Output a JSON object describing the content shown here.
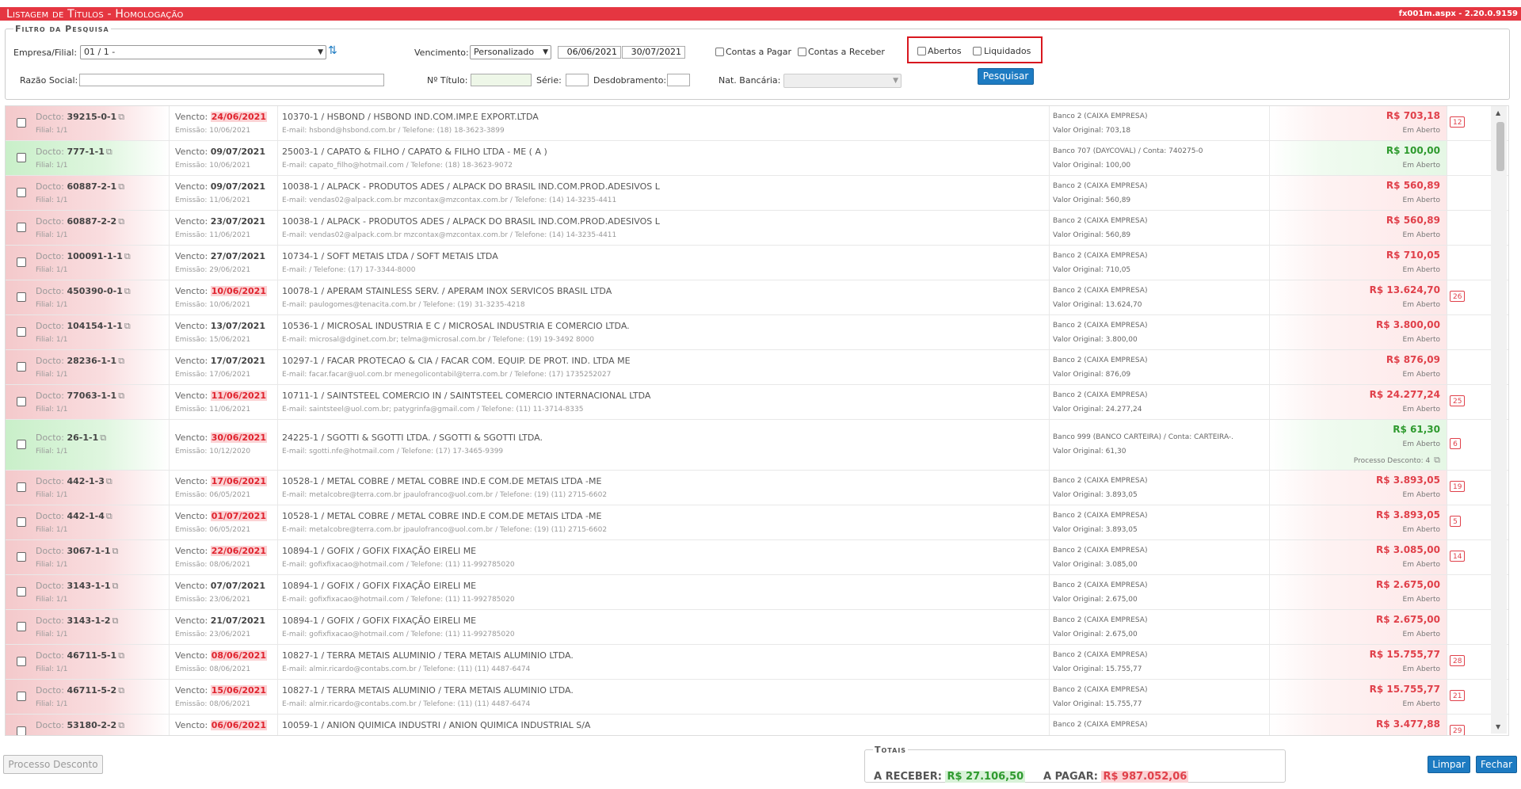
{
  "header": {
    "title": "Listagem de Títulos  - Homologação",
    "version": "fx001m.aspx - 2.20.0.9159"
  },
  "filter": {
    "legend": "Filtro da Pesquisa",
    "empresa_label": "Empresa/Filial:",
    "empresa_value": "01 / 1 -",
    "vencimento_label": "Vencimento:",
    "vencimento_value": "Personalizado",
    "date_from": "06/06/2021",
    "date_to": "30/07/2021",
    "contas_pagar": "Contas a Pagar",
    "contas_receber": "Contas a Receber",
    "abertos": "Abertos",
    "liquidados": "Liquidados",
    "razao_label": "Razão Social:",
    "razao_value": "",
    "titulo_label": "Nº Título:",
    "serie_label": "Série:",
    "desdobramento_label": "Desdobramento:",
    "natbancaria_label": "Nat. Bancária:",
    "pesquisar": "Pesquisar"
  },
  "labels": {
    "docto": "Docto:",
    "filial": "Filial: 1/1",
    "vencto": "Vencto:",
    "emissao": "Emissão:",
    "valor_original": "Valor Original:",
    "email": "E-mail:",
    "telefone": "Telefone:"
  },
  "rows": [
    {
      "status": "red",
      "doc": "39215-0-1",
      "venc": "24/06/2021",
      "late": true,
      "emis": "10/06/2021",
      "cli": "10370-1 / HSBOND / HSBOND IND.COM.IMP.E EXPORT.LTDA",
      "mail": "E-mail: hsbond@hsbond.com.br / Telefone: (18) 18-3623-3899",
      "banco": "Banco 2 (CAIXA EMPRESA)",
      "vorig": "Valor Original: 703,18",
      "valor": "R$ 703,18",
      "stat": "Em Aberto",
      "badge": "12"
    },
    {
      "status": "green",
      "doc": "777-1-1",
      "venc": "09/07/2021",
      "late": false,
      "emis": "10/06/2021",
      "cli": "25003-1 / CAPATO & FILHO / CAPATO & FILHO LTDA - ME ( A )",
      "mail": "E-mail: capato_filho@hotmail.com / Telefone: (18) 18-3623-9072",
      "banco": "Banco 707 (DAYCOVAL) / Conta: 740275-0",
      "vorig": "Valor Original: 100,00",
      "valor": "R$ 100,00",
      "stat": "Em Aberto",
      "badge": ""
    },
    {
      "status": "red",
      "doc": "60887-2-1",
      "venc": "09/07/2021",
      "late": false,
      "emis": "11/06/2021",
      "cli": "10038-1 / ALPACK - PRODUTOS ADES / ALPACK DO BRASIL IND.COM.PROD.ADESIVOS L",
      "mail": "E-mail: vendas02@alpack.com.br mzcontax@mzcontax.com.br / Telefone: (14) 14-3235-4411",
      "banco": "Banco 2 (CAIXA EMPRESA)",
      "vorig": "Valor Original: 560,89",
      "valor": "R$ 560,89",
      "stat": "Em Aberto",
      "badge": ""
    },
    {
      "status": "red",
      "doc": "60887-2-2",
      "venc": "23/07/2021",
      "late": false,
      "emis": "11/06/2021",
      "cli": "10038-1 / ALPACK - PRODUTOS ADES / ALPACK DO BRASIL IND.COM.PROD.ADESIVOS L",
      "mail": "E-mail: vendas02@alpack.com.br mzcontax@mzcontax.com.br / Telefone: (14) 14-3235-4411",
      "banco": "Banco 2 (CAIXA EMPRESA)",
      "vorig": "Valor Original: 560,89",
      "valor": "R$ 560,89",
      "stat": "Em Aberto",
      "badge": ""
    },
    {
      "status": "red",
      "doc": "100091-1-1",
      "venc": "27/07/2021",
      "late": false,
      "emis": "29/06/2021",
      "cli": "10734-1 / SOFT METAIS LTDA / SOFT METAIS LTDA",
      "mail": "E-mail: / Telefone: (17) 17-3344-8000",
      "banco": "Banco 2 (CAIXA EMPRESA)",
      "vorig": "Valor Original: 710,05",
      "valor": "R$ 710,05",
      "stat": "Em Aberto",
      "badge": ""
    },
    {
      "status": "red",
      "doc": "450390-0-1",
      "venc": "10/06/2021",
      "late": true,
      "emis": "10/06/2021",
      "cli": "10078-1 / APERAM STAINLESS SERV. / APERAM INOX SERVICOS BRASIL LTDA",
      "mail": "E-mail: paulogomes@tenacita.com.br / Telefone: (19) 31-3235-4218",
      "banco": "Banco 2 (CAIXA EMPRESA)",
      "vorig": "Valor Original: 13.624,70",
      "valor": "R$ 13.624,70",
      "stat": "Em Aberto",
      "badge": "26"
    },
    {
      "status": "red",
      "doc": "104154-1-1",
      "venc": "13/07/2021",
      "late": false,
      "emis": "15/06/2021",
      "cli": "10536-1 / MICROSAL INDUSTRIA E C / MICROSAL INDUSTRIA E COMERCIO LTDA.",
      "mail": "E-mail: microsal@dginet.com.br; telma@microsal.com.br / Telefone: (19) 19-3492 8000",
      "banco": "Banco 2 (CAIXA EMPRESA)",
      "vorig": "Valor Original: 3.800,00",
      "valor": "R$ 3.800,00",
      "stat": "Em Aberto",
      "badge": ""
    },
    {
      "status": "red",
      "doc": "28236-1-1",
      "venc": "17/07/2021",
      "late": false,
      "emis": "17/06/2021",
      "cli": "10297-1 / FACAR PROTECAO & CIA / FACAR COM. EQUIP. DE PROT. IND. LTDA ME",
      "mail": "E-mail: facar.facar@uol.com.br menegolicontabil@terra.com.br / Telefone: (17) 1735252027",
      "banco": "Banco 2 (CAIXA EMPRESA)",
      "vorig": "Valor Original: 876,09",
      "valor": "R$ 876,09",
      "stat": "Em Aberto",
      "badge": ""
    },
    {
      "status": "red",
      "doc": "77063-1-1",
      "venc": "11/06/2021",
      "late": true,
      "emis": "11/06/2021",
      "cli": "10711-1 / SAINTSTEEL COMERCIO IN / SAINTSTEEL COMERCIO INTERNACIONAL LTDA",
      "mail": "E-mail: saintsteel@uol.com.br; patygrinfa@gmail.com / Telefone: (11) 11-3714-8335",
      "banco": "Banco 2 (CAIXA EMPRESA)",
      "vorig": "Valor Original: 24.277,24",
      "valor": "R$ 24.277,24",
      "stat": "Em Aberto",
      "badge": "25"
    },
    {
      "status": "green",
      "tall": true,
      "doc": "26-1-1",
      "venc": "30/06/2021",
      "late": true,
      "emis": "10/12/2020",
      "cli": "24225-1 / SGOTTI & SGOTTI LTDA. / SGOTTI & SGOTTI LTDA.",
      "mail": "E-mail: sgotti.nfe@hotmail.com / Telefone: (17) 17-3465-9399",
      "banco": "Banco 999 (BANCO CARTEIRA) / Conta: CARTEIRA-.",
      "vorig": "Valor Original: 61,30",
      "valor": "R$ 61,30",
      "stat": "Em Aberto",
      "pdesc": "Processo Desconto: 4",
      "badge": "6"
    },
    {
      "status": "red",
      "doc": "442-1-3",
      "venc": "17/06/2021",
      "late": true,
      "emis": "06/05/2021",
      "cli": "10528-1 / METAL COBRE / METAL COBRE IND.E COM.DE METAIS LTDA -ME",
      "mail": "E-mail: metalcobre@terra.com.br jpaulofranco@uol.com.br / Telefone: (19) (11) 2715-6602",
      "banco": "Banco 2 (CAIXA EMPRESA)",
      "vorig": "Valor Original: 3.893,05",
      "valor": "R$ 3.893,05",
      "stat": "Em Aberto",
      "badge": "19"
    },
    {
      "status": "red",
      "doc": "442-1-4",
      "venc": "01/07/2021",
      "late": true,
      "emis": "06/05/2021",
      "cli": "10528-1 / METAL COBRE / METAL COBRE IND.E COM.DE METAIS LTDA -ME",
      "mail": "E-mail: metalcobre@terra.com.br jpaulofranco@uol.com.br / Telefone: (19) (11) 2715-6602",
      "banco": "Banco 2 (CAIXA EMPRESA)",
      "vorig": "Valor Original: 3.893,05",
      "valor": "R$ 3.893,05",
      "stat": "Em Aberto",
      "badge": "5"
    },
    {
      "status": "red",
      "doc": "3067-1-1",
      "venc": "22/06/2021",
      "late": true,
      "emis": "08/06/2021",
      "cli": "10894-1 / GOFIX / GOFIX FIXAÇÃO EIRELI ME",
      "mail": "E-mail: gofixfixacao@hotmail.com / Telefone: (11) 11-992785020",
      "banco": "Banco 2 (CAIXA EMPRESA)",
      "vorig": "Valor Original: 3.085,00",
      "valor": "R$ 3.085,00",
      "stat": "Em Aberto",
      "badge": "14"
    },
    {
      "status": "red",
      "doc": "3143-1-1",
      "venc": "07/07/2021",
      "late": false,
      "emis": "23/06/2021",
      "cli": "10894-1 / GOFIX / GOFIX FIXAÇÃO EIRELI ME",
      "mail": "E-mail: gofixfixacao@hotmail.com / Telefone: (11) 11-992785020",
      "banco": "Banco 2 (CAIXA EMPRESA)",
      "vorig": "Valor Original: 2.675,00",
      "valor": "R$ 2.675,00",
      "stat": "Em Aberto",
      "badge": ""
    },
    {
      "status": "red",
      "doc": "3143-1-2",
      "venc": "21/07/2021",
      "late": false,
      "emis": "23/06/2021",
      "cli": "10894-1 / GOFIX / GOFIX FIXAÇÃO EIRELI ME",
      "mail": "E-mail: gofixfixacao@hotmail.com / Telefone: (11) 11-992785020",
      "banco": "Banco 2 (CAIXA EMPRESA)",
      "vorig": "Valor Original: 2.675,00",
      "valor": "R$ 2.675,00",
      "stat": "Em Aberto",
      "badge": ""
    },
    {
      "status": "red",
      "doc": "46711-5-1",
      "venc": "08/06/2021",
      "late": true,
      "emis": "08/06/2021",
      "cli": "10827-1 / TERRA METAIS ALUMINIO / TERA METAIS ALUMINIO LTDA.",
      "mail": "E-mail: almir.ricardo@contabs.com.br / Telefone: (11) (11) 4487-6474",
      "banco": "Banco 2 (CAIXA EMPRESA)",
      "vorig": "Valor Original: 15.755,77",
      "valor": "R$ 15.755,77",
      "stat": "Em Aberto",
      "badge": "28"
    },
    {
      "status": "red",
      "doc": "46711-5-2",
      "venc": "15/06/2021",
      "late": true,
      "emis": "08/06/2021",
      "cli": "10827-1 / TERRA METAIS ALUMINIO / TERA METAIS ALUMINIO LTDA.",
      "mail": "E-mail: almir.ricardo@contabs.com.br / Telefone: (11) (11) 4487-6474",
      "banco": "Banco 2 (CAIXA EMPRESA)",
      "vorig": "Valor Original: 15.755,77",
      "valor": "R$ 15.755,77",
      "stat": "Em Aberto",
      "badge": "21"
    },
    {
      "status": "red",
      "doc": "53180-2-2",
      "venc": "06/06/2021",
      "late": true,
      "emis": "",
      "cli": "10059-1 / ANION QUIMICA INDUSTRI / ANION QUIMICA INDUSTRIAL S/A",
      "mail": "",
      "banco": "Banco 2 (CAIXA EMPRESA)",
      "vorig": "",
      "valor": "R$ 3.477,88",
      "stat": "Em Aberto",
      "badge": "29"
    }
  ],
  "footer": {
    "processo_desconto": "Processo Desconto",
    "totais_legend": "Totais",
    "a_receber_label": "A RECEBER:",
    "a_receber_value": "R$ 27.106,50",
    "a_pagar_label": "A PAGAR:",
    "a_pagar_value": "R$ 987.052,06",
    "limpar": "Limpar",
    "fechar": "Fechar"
  },
  "colors": {
    "header_red": "#e53641",
    "primary_blue": "#1d7bc2",
    "overdue_red": "#e0404a",
    "open_green": "#2e9a2e"
  }
}
